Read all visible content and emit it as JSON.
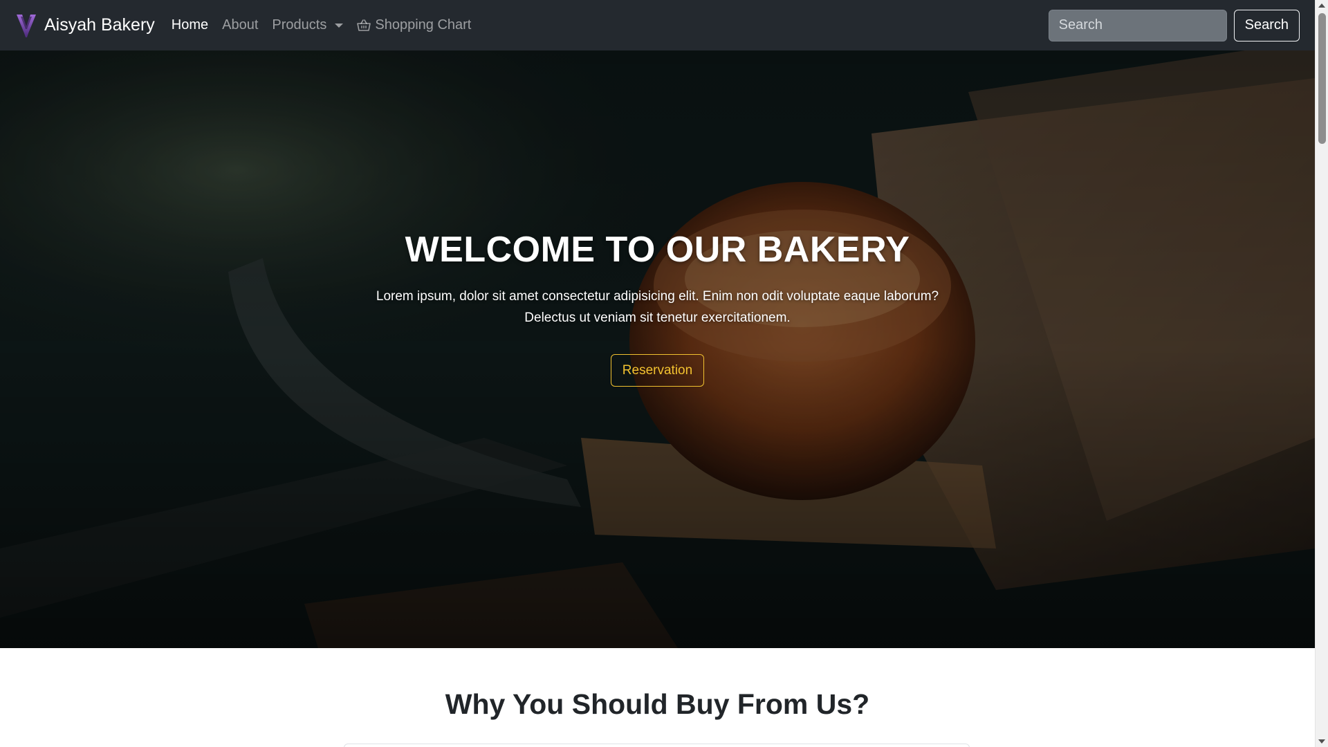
{
  "navbar": {
    "brand": "Aisyah Bakery",
    "links": [
      {
        "label": "Home",
        "active": true
      },
      {
        "label": "About",
        "active": false
      },
      {
        "label": "Products",
        "active": false
      },
      {
        "label": "Shopping Chart",
        "active": false
      }
    ],
    "search": {
      "placeholder": "Search",
      "value": "",
      "button_label": "Search"
    },
    "icons": {
      "brand": "bakery-logo-icon",
      "products": "caret-down-icon",
      "cart": "basket-icon"
    }
  },
  "hero": {
    "title": "WELCOME TO OUR BAKERY",
    "text_line_1": "Lorem ipsum, dolor sit amet consectetur adipisicing elit. Enim non odit voluptate eaque laborum?",
    "text_line_2": "Delectus ut veniam sit tenetur exercitationem.",
    "button_label": "Reservation"
  },
  "why_section": {
    "title": "Why You Should Buy From Us?"
  },
  "colors": {
    "navbar_bg": "#24292f",
    "accent": "#f2c230",
    "text_dark": "#212529"
  }
}
